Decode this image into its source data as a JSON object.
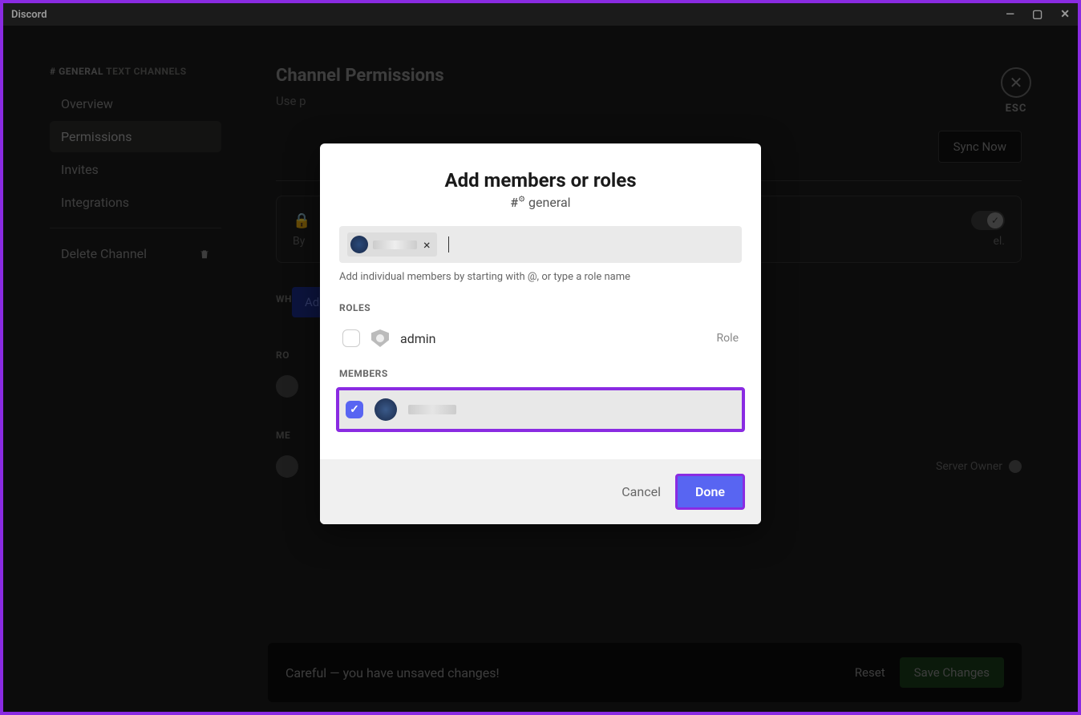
{
  "titlebar": {
    "app_name": "Discord"
  },
  "sidebar": {
    "channel_prefix": "# GENERAL",
    "channel_suffix": "TEXT CHANNELS",
    "items": [
      {
        "label": "Overview"
      },
      {
        "label": "Permissions"
      },
      {
        "label": "Invites"
      },
      {
        "label": "Integrations"
      }
    ],
    "delete_label": "Delete Channel"
  },
  "content": {
    "title": "Channel Permissions",
    "subtitle": "Use p",
    "sync_button": "Sync Now",
    "private_desc_suffix": "el.",
    "who_label": "WH",
    "add_button": "Add members or roles",
    "roles_label": "RO",
    "members_label": "ME",
    "server_owner": "Server Owner"
  },
  "close_panel": {
    "esc": "ESC"
  },
  "save_bar": {
    "message": "Careful — you have unsaved changes!",
    "reset": "Reset",
    "save": "Save Changes"
  },
  "modal": {
    "title": "Add members or roles",
    "channel": "general",
    "hint": "Add individual members by starting with @, or type a role name",
    "roles_header": "ROLES",
    "members_header": "MEMBERS",
    "role_items": [
      {
        "name": "admin",
        "type": "Role",
        "checked": false
      }
    ],
    "cancel": "Cancel",
    "done": "Done"
  }
}
